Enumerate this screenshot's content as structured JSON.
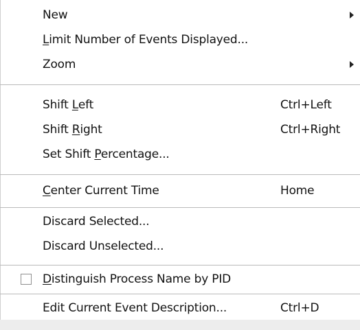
{
  "menu": {
    "items": [
      {
        "label": "New",
        "submenu": true
      },
      {
        "label_pre": "",
        "label_u": "L",
        "label_post": "imit Number of Events Displayed..."
      },
      {
        "label": "Zoom",
        "submenu": true
      },
      {
        "label_pre": "Shift ",
        "label_u": "L",
        "label_post": "eft",
        "accel": "Ctrl+Left"
      },
      {
        "label_pre": "Shift ",
        "label_u": "R",
        "label_post": "ight",
        "accel": "Ctrl+Right"
      },
      {
        "label_pre": "Set Shift ",
        "label_u": "P",
        "label_post": "ercentage...",
        "accel": ""
      },
      {
        "label_pre": "",
        "label_u": "C",
        "label_post": "enter Current Time",
        "accel": "Home"
      },
      {
        "label": "Discard Selected..."
      },
      {
        "label": "Discard Unselected..."
      },
      {
        "label_pre": "",
        "label_u": "D",
        "label_post": "istinguish Process Name by PID",
        "checked": false
      },
      {
        "label": "Edit Current Event Description...",
        "accel": "Ctrl+D"
      }
    ]
  },
  "icons": {
    "submenu": "submenu-arrow-icon",
    "checkbox": "checkbox-icon"
  },
  "colors": {
    "background": "#ffffff",
    "separator": "#b9b9b9",
    "text": "#111111"
  }
}
